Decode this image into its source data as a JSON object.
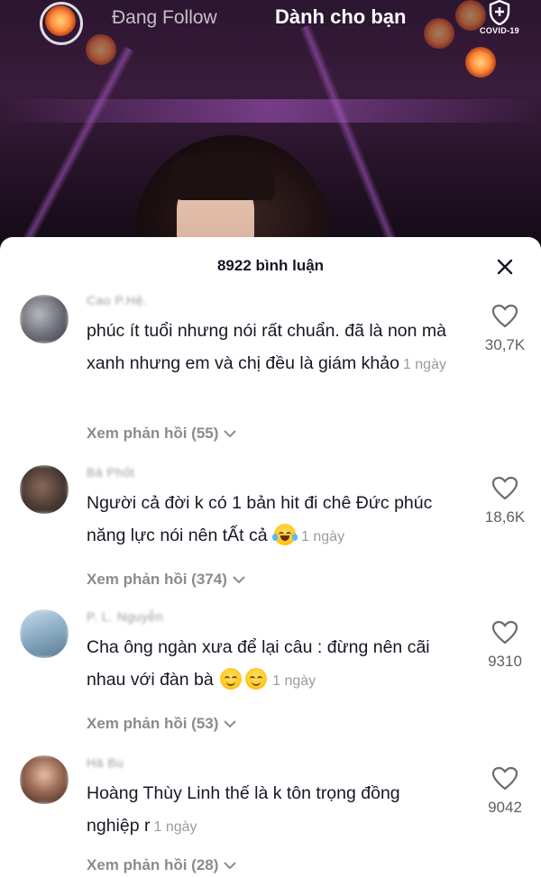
{
  "video": {
    "tabs": {
      "following": "Đang Follow",
      "for_you": "Dành cho bạn"
    },
    "covid_label": "COVID-19"
  },
  "comments_sheet": {
    "title": "8922 bình luận",
    "close_icon": "close-icon",
    "comments": [
      {
        "username": "Cao P.Hệ.",
        "text": "phúc ít tuổi nhưng nói rất chuẩn. đã là non mà xanh nhưng em và chị đều là giám khảo",
        "emojis": [],
        "time": "1 ngày",
        "replies": "Xem phản hồi (55)",
        "likes": "30,7K",
        "avatar_color": "#7a7a85"
      },
      {
        "username": "Bả Phốt",
        "text": "Người cả đời k có 1 bản hit đi chê Đức phúc năng lực nói nên tẤt cả",
        "emojis": [
          "laughing-tears"
        ],
        "time": "1 ngày",
        "replies": "Xem phản hồi (374)",
        "likes": "18,6K",
        "avatar_color": "#5a4a44"
      },
      {
        "username": "P. L. Nguyễn",
        "text": "Cha ông ngàn xưa để lại câu : đừng nên cãi nhau với đàn bà",
        "emojis": [
          "relieved",
          "relieved"
        ],
        "time": "1 ngày",
        "replies": "Xem phản hồi (53)",
        "likes": "9310",
        "avatar_color": "#8fb0c8"
      },
      {
        "username": "Hà Bu",
        "text": "Hoàng Thùy Linh thế là k tôn trọng đồng nghiệp r",
        "emojis": [],
        "time": "1 ngày",
        "replies": "Xem phản hồi (28)",
        "likes": "9042",
        "avatar_color": "#6a4a3a"
      }
    ]
  }
}
